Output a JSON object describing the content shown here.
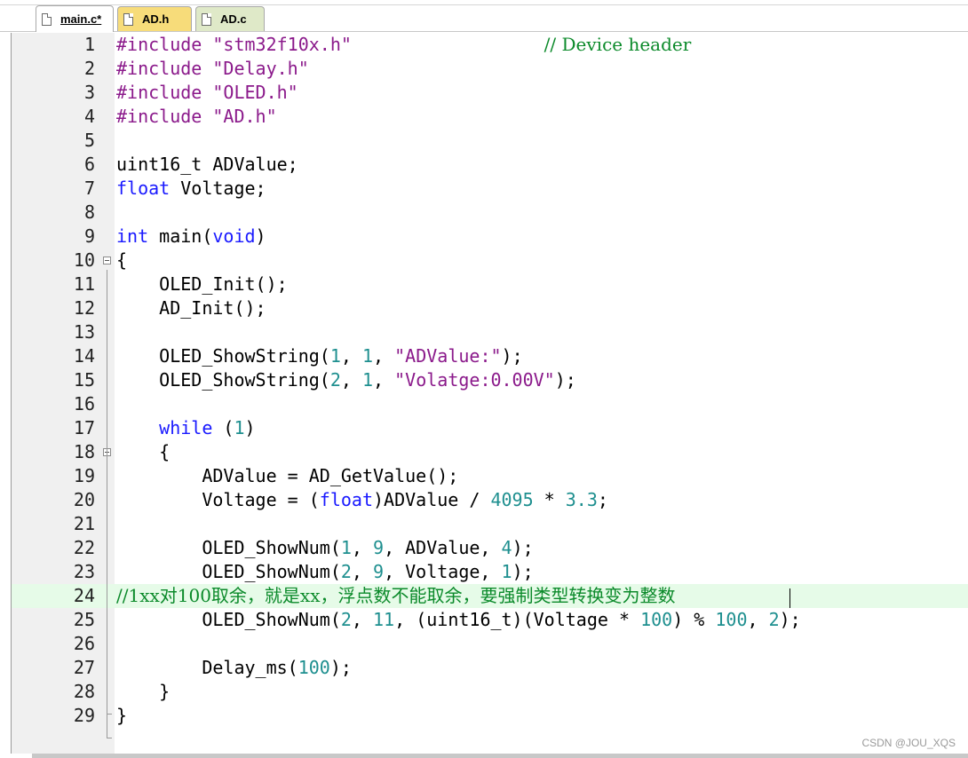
{
  "tabs": [
    {
      "label": "main.c*",
      "active": true,
      "color": "#ffffff"
    },
    {
      "label": "AD.h",
      "active": false,
      "color": "#f7dc7a"
    },
    {
      "label": "AD.c",
      "active": false,
      "color": "#dfe9c8"
    }
  ],
  "editor": {
    "lines": [
      {
        "n": "1",
        "tokens": [
          [
            "pre",
            "#include "
          ],
          [
            "str",
            "\"stm32f10x.h\""
          ],
          [
            "txt",
            "                  "
          ],
          [
            "cmt",
            "// Device header"
          ]
        ]
      },
      {
        "n": "2",
        "tokens": [
          [
            "pre",
            "#include "
          ],
          [
            "str",
            "\"Delay.h\""
          ]
        ]
      },
      {
        "n": "3",
        "tokens": [
          [
            "pre",
            "#include "
          ],
          [
            "str",
            "\"OLED.h\""
          ]
        ]
      },
      {
        "n": "4",
        "tokens": [
          [
            "pre",
            "#include "
          ],
          [
            "str",
            "\"AD.h\""
          ]
        ]
      },
      {
        "n": "5",
        "tokens": []
      },
      {
        "n": "6",
        "tokens": [
          [
            "txt",
            "uint16_t ADValue;"
          ]
        ]
      },
      {
        "n": "7",
        "tokens": [
          [
            "kw",
            "float"
          ],
          [
            "txt",
            " Voltage;"
          ]
        ]
      },
      {
        "n": "8",
        "tokens": []
      },
      {
        "n": "9",
        "tokens": [
          [
            "kw",
            "int"
          ],
          [
            "txt",
            " main("
          ],
          [
            "kw",
            "void"
          ],
          [
            "txt",
            ")"
          ]
        ]
      },
      {
        "n": "10",
        "tokens": [
          [
            "txt",
            "{"
          ]
        ],
        "fold": true
      },
      {
        "n": "11",
        "tokens": [
          [
            "txt",
            "    OLED_Init();"
          ]
        ]
      },
      {
        "n": "12",
        "tokens": [
          [
            "txt",
            "    AD_Init();"
          ]
        ]
      },
      {
        "n": "13",
        "tokens": []
      },
      {
        "n": "14",
        "tokens": [
          [
            "txt",
            "    OLED_ShowString("
          ],
          [
            "num",
            "1"
          ],
          [
            "txt",
            ", "
          ],
          [
            "num",
            "1"
          ],
          [
            "txt",
            ", "
          ],
          [
            "str",
            "\"ADValue:\""
          ],
          [
            "txt",
            ");"
          ]
        ]
      },
      {
        "n": "15",
        "tokens": [
          [
            "txt",
            "    OLED_ShowString("
          ],
          [
            "num",
            "2"
          ],
          [
            "txt",
            ", "
          ],
          [
            "num",
            "1"
          ],
          [
            "txt",
            ", "
          ],
          [
            "str",
            "\"Volatge:0.00V\""
          ],
          [
            "txt",
            ");"
          ]
        ]
      },
      {
        "n": "16",
        "tokens": []
      },
      {
        "n": "17",
        "tokens": [
          [
            "txt",
            "    "
          ],
          [
            "kw",
            "while"
          ],
          [
            "txt",
            " ("
          ],
          [
            "num",
            "1"
          ],
          [
            "txt",
            ")"
          ]
        ]
      },
      {
        "n": "18",
        "tokens": [
          [
            "txt",
            "    {"
          ]
        ],
        "fold": true
      },
      {
        "n": "19",
        "tokens": [
          [
            "txt",
            "        ADValue = AD_GetValue();"
          ]
        ]
      },
      {
        "n": "20",
        "tokens": [
          [
            "txt",
            "        Voltage = ("
          ],
          [
            "kw",
            "float"
          ],
          [
            "txt",
            ")ADValue / "
          ],
          [
            "num",
            "4095"
          ],
          [
            "txt",
            " * "
          ],
          [
            "num",
            "3.3"
          ],
          [
            "txt",
            ";"
          ]
        ]
      },
      {
        "n": "21",
        "tokens": []
      },
      {
        "n": "22",
        "tokens": [
          [
            "txt",
            "        OLED_ShowNum("
          ],
          [
            "num",
            "1"
          ],
          [
            "txt",
            ", "
          ],
          [
            "num",
            "9"
          ],
          [
            "txt",
            ", ADValue, "
          ],
          [
            "num",
            "4"
          ],
          [
            "txt",
            ");"
          ]
        ]
      },
      {
        "n": "23",
        "tokens": [
          [
            "txt",
            "        OLED_ShowNum("
          ],
          [
            "num",
            "2"
          ],
          [
            "txt",
            ", "
          ],
          [
            "num",
            "9"
          ],
          [
            "txt",
            ", Voltage, "
          ],
          [
            "num",
            "1"
          ],
          [
            "txt",
            ");"
          ]
        ]
      },
      {
        "n": "24",
        "tokens": [
          [
            "cmt",
            "//1xx对100取余，就是xx，浮点数不能取余，要强制类型转换变为整数"
          ]
        ],
        "highlight": true
      },
      {
        "n": "25",
        "tokens": [
          [
            "txt",
            "        OLED_ShowNum("
          ],
          [
            "num",
            "2"
          ],
          [
            "txt",
            ", "
          ],
          [
            "num",
            "11"
          ],
          [
            "txt",
            ", (uint16_t)(Voltage * "
          ],
          [
            "num",
            "100"
          ],
          [
            "txt",
            ") % "
          ],
          [
            "num",
            "100"
          ],
          [
            "txt",
            ", "
          ],
          [
            "num",
            "2"
          ],
          [
            "txt",
            ");"
          ]
        ]
      },
      {
        "n": "26",
        "tokens": []
      },
      {
        "n": "27",
        "tokens": [
          [
            "txt",
            "        Delay_ms("
          ],
          [
            "num",
            "100"
          ],
          [
            "txt",
            ");"
          ]
        ]
      },
      {
        "n": "28",
        "tokens": [
          [
            "txt",
            "    }"
          ]
        ]
      },
      {
        "n": "29",
        "tokens": [
          [
            "txt",
            "}"
          ]
        ]
      }
    ]
  },
  "watermark": "CSDN @JOU_XQS"
}
